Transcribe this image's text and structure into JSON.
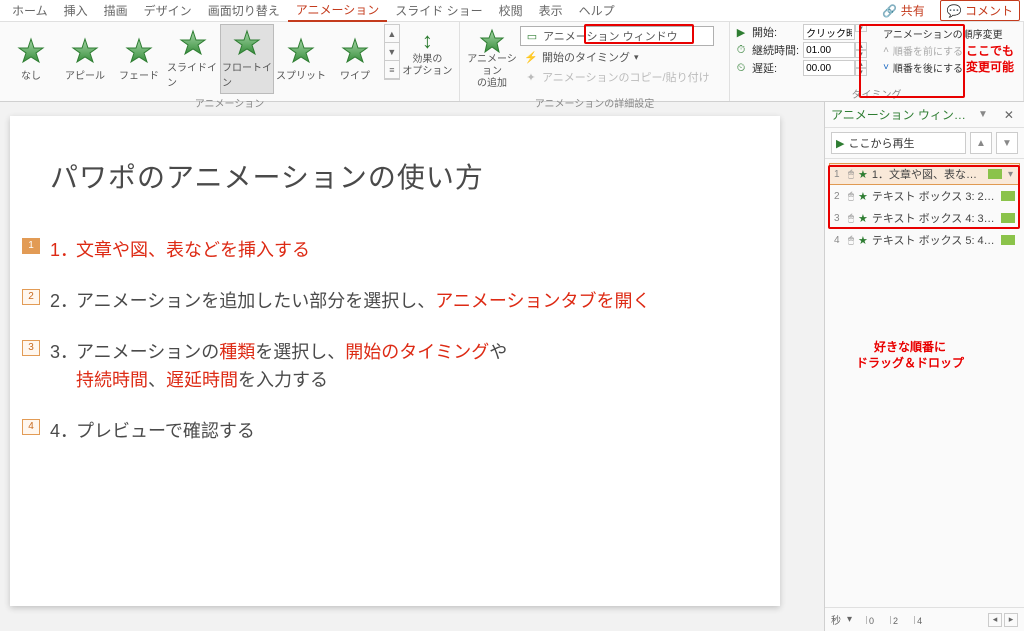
{
  "tabs": {
    "home": "ホーム",
    "insert": "挿入",
    "draw": "描画",
    "design": "デザイン",
    "transition": "画面切り替え",
    "animation": "アニメーション",
    "slideshow": "スライド ショー",
    "review": "校閲",
    "view": "表示",
    "help": "ヘルプ"
  },
  "topbar": {
    "share": "共有",
    "comment": "コメント"
  },
  "gallery": {
    "items": [
      {
        "id": "none",
        "label": "なし",
        "fill": "#b0b0b0"
      },
      {
        "id": "appear",
        "label": "アピール",
        "fill": "#4caf50"
      },
      {
        "id": "fade",
        "label": "フェード",
        "fill": "#4caf50"
      },
      {
        "id": "slidein",
        "label": "スライドイン",
        "fill": "#4caf50"
      },
      {
        "id": "floatin",
        "label": "フロートイン",
        "fill": "#4caf50"
      },
      {
        "id": "split",
        "label": "スプリット",
        "fill": "#4caf50"
      },
      {
        "id": "wipe",
        "label": "ワイプ",
        "fill": "#4caf50"
      }
    ],
    "group_label": "アニメーション",
    "selected": "floatin"
  },
  "effect_options": {
    "label": "効果の\nオプション"
  },
  "advanced": {
    "add": "アニメーション\nの追加",
    "pane": "アニメーション ウィンドウ",
    "trigger": "開始のタイミング",
    "painter": "アニメーションのコピー/貼り付け",
    "group_label": "アニメーションの詳細設定"
  },
  "timing": {
    "start_label": "開始:",
    "start_value": "クリック時",
    "duration_label": "継続時間:",
    "duration_value": "01.00",
    "delay_label": "遅延:",
    "delay_value": "00.00",
    "group_label": "タイミング",
    "reorder_header": "アニメーションの順序変更",
    "move_earlier": "順番を前にする",
    "move_later": "順番を後にする"
  },
  "slide": {
    "title": "パワポのアニメーションの使い方",
    "items": [
      {
        "num": "1．",
        "text": "文章や図、表などを挿入する",
        "tag": "1",
        "sel": true
      },
      {
        "num": "2．",
        "text": "アニメーションを追加したい部分を選択し、",
        "tag": "2",
        "highlight_tail": "アニメーションタブを開く"
      },
      {
        "num": "3．",
        "pre": "アニメーションの",
        "h1": "種類",
        "mid": "を選択し、",
        "h2": "開始のタイミング",
        "post": "や",
        "tag": "3",
        "line2_h": "持続時間",
        "line2_a": "、",
        "line2_h2": "遅延時間",
        "line2_b": "を入力する"
      },
      {
        "num": "4．",
        "text": "プレビューで確認する",
        "tag": "4"
      }
    ]
  },
  "pane": {
    "title": "アニメーション ウィン…",
    "play": "ここから再生",
    "items": [
      {
        "n": "1",
        "name": "1．文章や図、表など…",
        "sel": true
      },
      {
        "n": "2",
        "name": "テキスト ボックス 3: 2…"
      },
      {
        "n": "3",
        "name": "テキスト ボックス 4: 3…"
      },
      {
        "n": "4",
        "name": "テキスト ボックス 5: 4…"
      }
    ],
    "seconds": "秒",
    "timeline": [
      "0",
      "2",
      "4"
    ]
  },
  "annotations": {
    "top_right": "ここでも\n変更可能",
    "pane": "好きな順番に\nドラッグ＆ドロップ"
  }
}
